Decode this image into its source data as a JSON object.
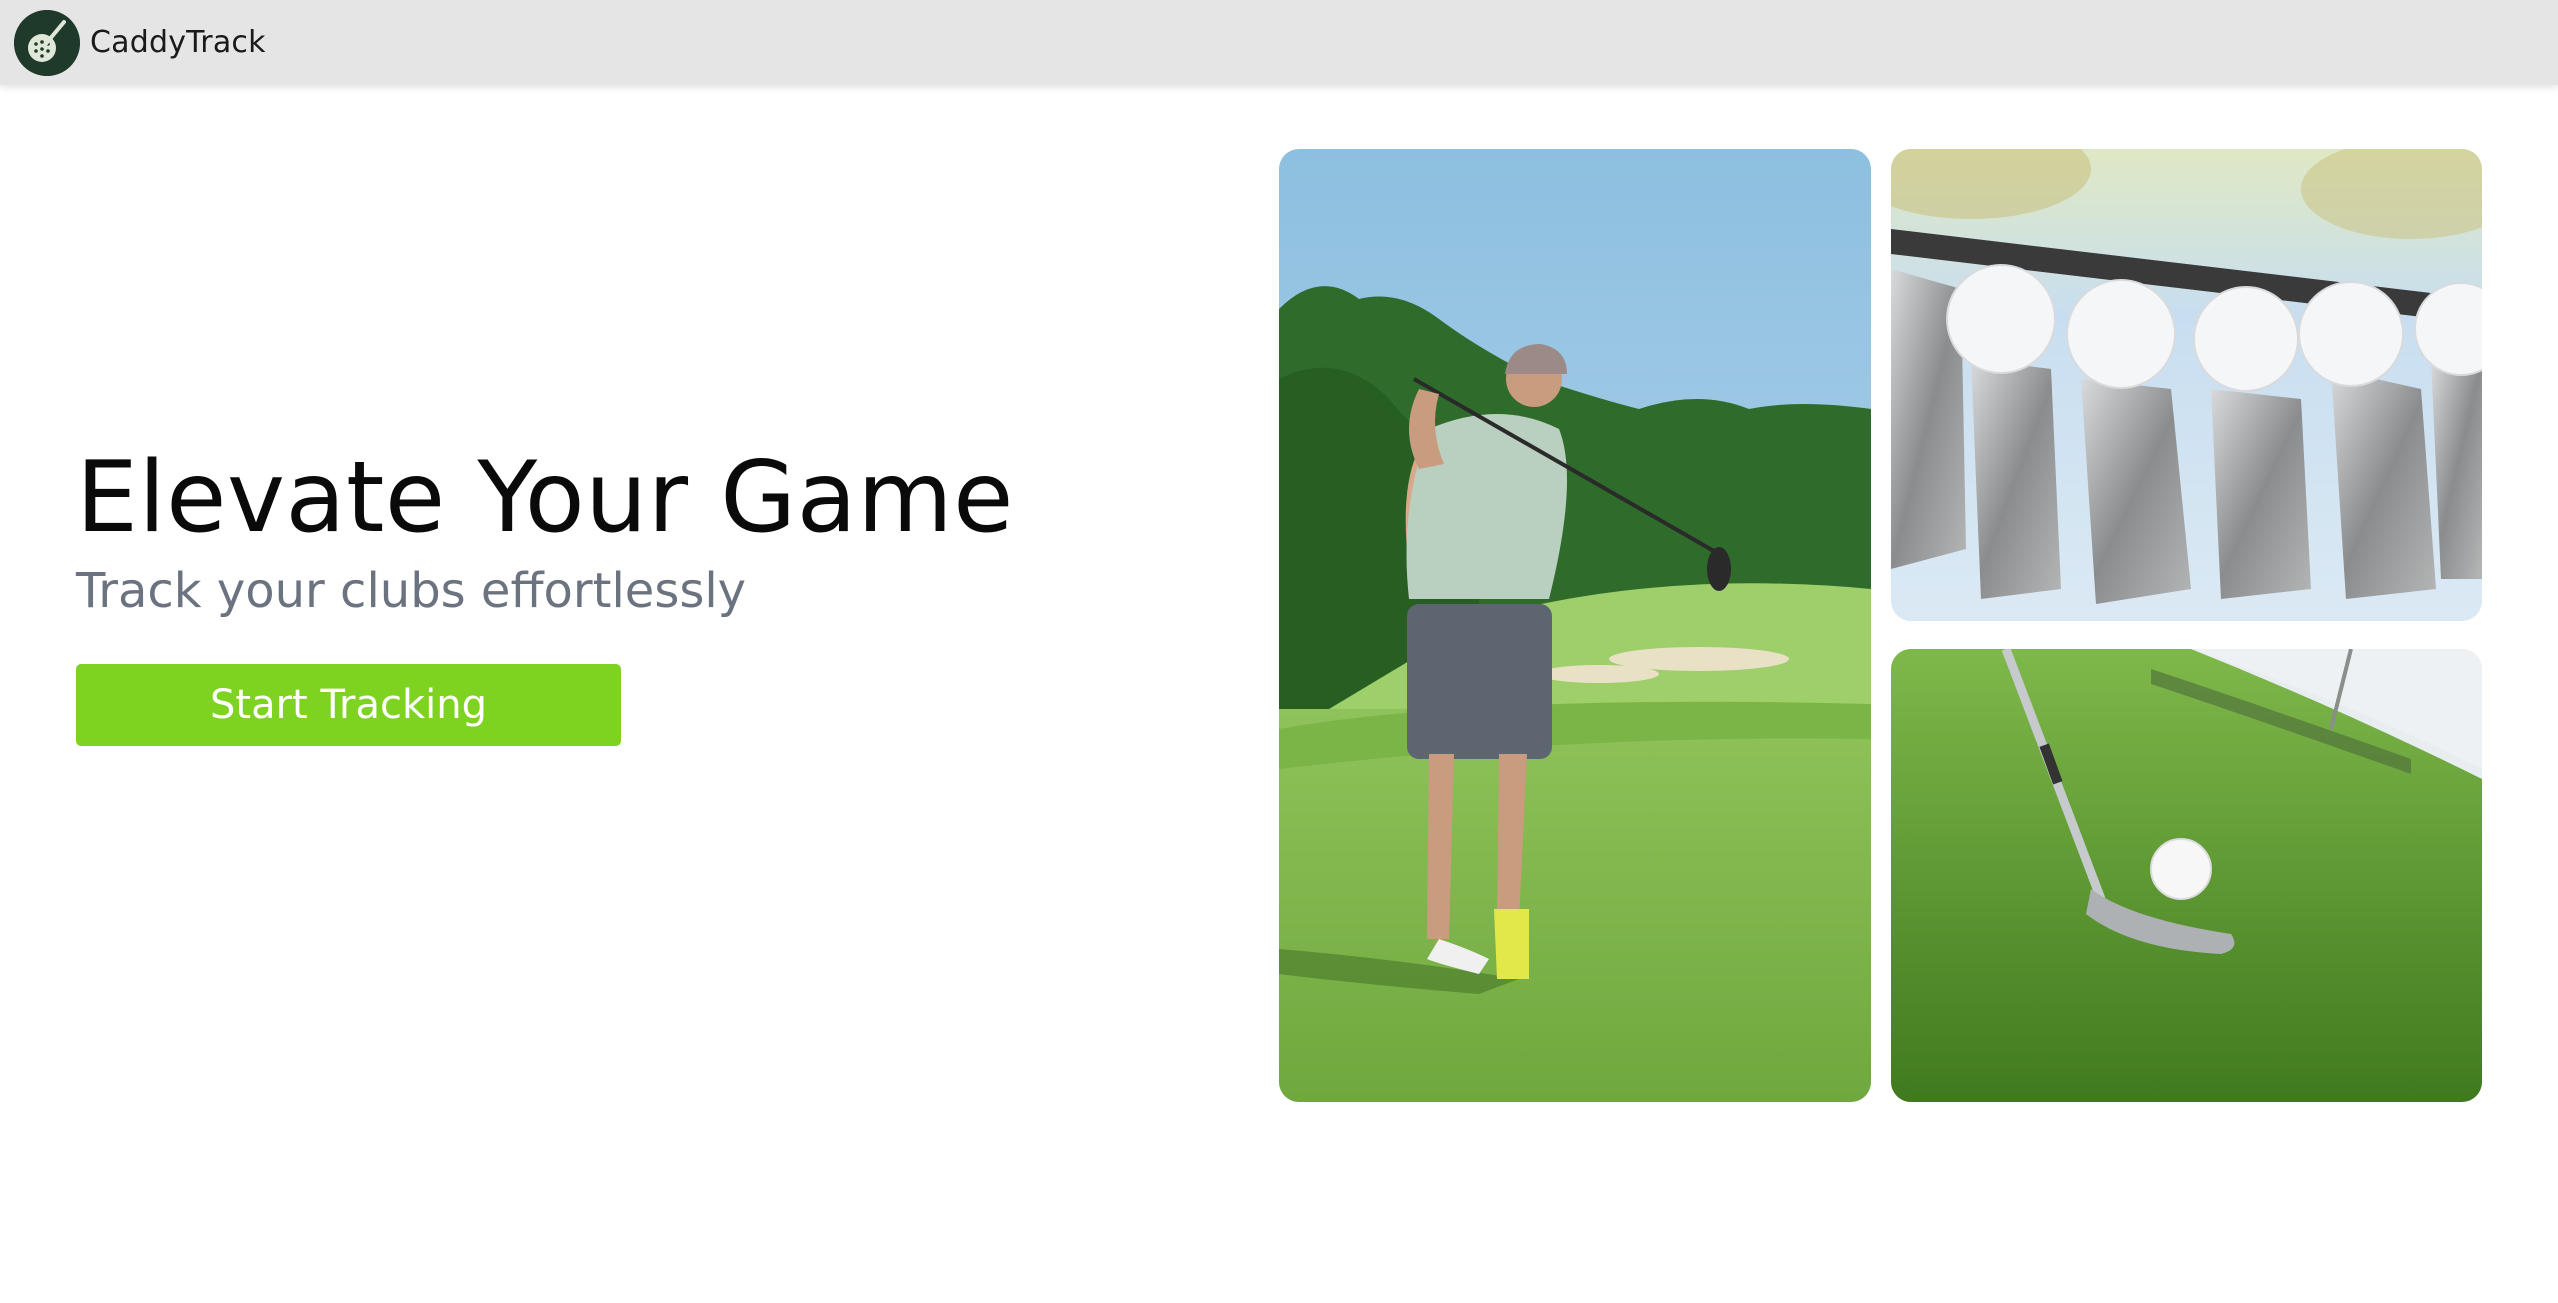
{
  "header": {
    "brand": "CaddyTrack",
    "logo_icon": "golf-ball-club-icon",
    "background": "#e5e5e5"
  },
  "hero": {
    "headline": "Elevate Your Game",
    "subheadline": "Track your clubs effortlessly",
    "cta_label": "Start Tracking",
    "cta_color": "#7ed321"
  },
  "gallery": [
    {
      "name": "golfer-swing-photo",
      "alt": "Golfer finishing a swing on a fairway"
    },
    {
      "name": "golf-clubs-balls-photo",
      "alt": "Row of golf balls resting on iron club heads"
    },
    {
      "name": "wedge-ball-grass-photo",
      "alt": "Wedge behind a golf ball on green grass"
    }
  ]
}
